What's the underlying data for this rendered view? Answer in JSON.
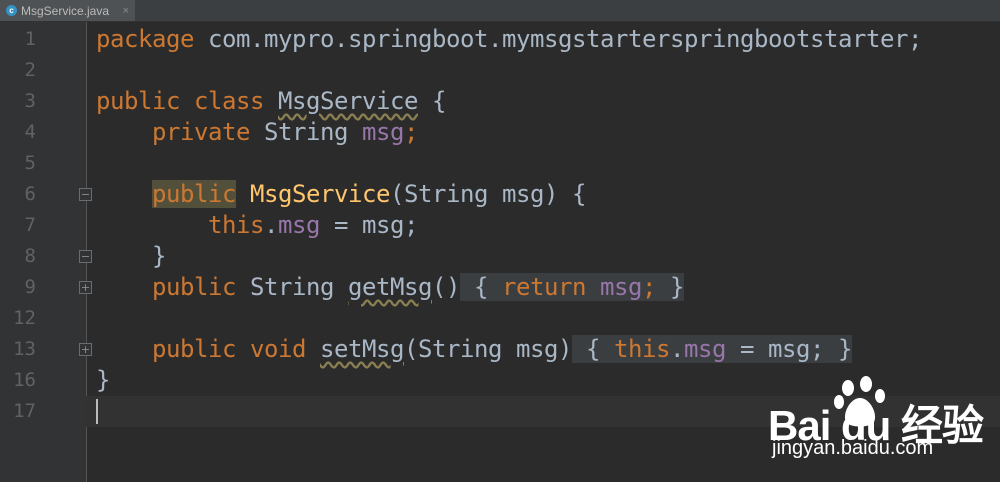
{
  "tab": {
    "file_icon_glyph": "c",
    "title": "MsgService.java",
    "close_glyph": "×"
  },
  "lines": [
    {
      "n": "1"
    },
    {
      "n": "2"
    },
    {
      "n": "3"
    },
    {
      "n": "4"
    },
    {
      "n": "5"
    },
    {
      "n": "6"
    },
    {
      "n": "7"
    },
    {
      "n": "8"
    },
    {
      "n": "9"
    },
    {
      "n": "12"
    },
    {
      "n": "13"
    },
    {
      "n": "16"
    },
    {
      "n": "17"
    }
  ],
  "code": {
    "l1": {
      "kw": "package",
      "rest": " com.mypro.springboot.mymsgstarterspringbootstarter;"
    },
    "l3": {
      "kw1": "public",
      "kw2": "class",
      "cls": "MsgService",
      "brace": " {"
    },
    "l4": {
      "indent": "    ",
      "kw": "private",
      "type": " String ",
      "field": "msg",
      "semi": ";"
    },
    "l6": {
      "indent": "    ",
      "kw": "public",
      "sp": " ",
      "fn": "MsgService",
      "params": "(String msg) {"
    },
    "l7": {
      "indent": "        ",
      "kw": "this",
      "dot": ".",
      "field": "msg",
      "rest": " = msg;"
    },
    "l8": {
      "indent": "    ",
      "brace": "}"
    },
    "l9": {
      "indent": "    ",
      "kw": "public",
      "type": " String ",
      "method": "getMsg",
      "parens": "()",
      "fold_open": " { ",
      "kw_return": "return",
      "sp": " ",
      "field": "msg",
      "semi": ";",
      "fold_close": " }"
    },
    "l13": {
      "indent": "    ",
      "kw": "public",
      "sp1": " ",
      "kw_void": "void",
      "sp2": " ",
      "method": "setMsg",
      "params": "(String msg)",
      "fold_open": " { ",
      "kw_this": "this",
      "dot": ".",
      "field": "msg",
      "rest": " = msg;",
      "fold_close": " }"
    },
    "l16": {
      "brace": "}"
    }
  },
  "watermark": {
    "brand": "Bai du 经验",
    "url": "jingyan.baidu.com"
  },
  "colors": {
    "background": "#2b2b2b",
    "keyword": "#cc7832",
    "field": "#9876aa",
    "method_decl": "#ffc66d",
    "text": "#a9b7c6"
  }
}
